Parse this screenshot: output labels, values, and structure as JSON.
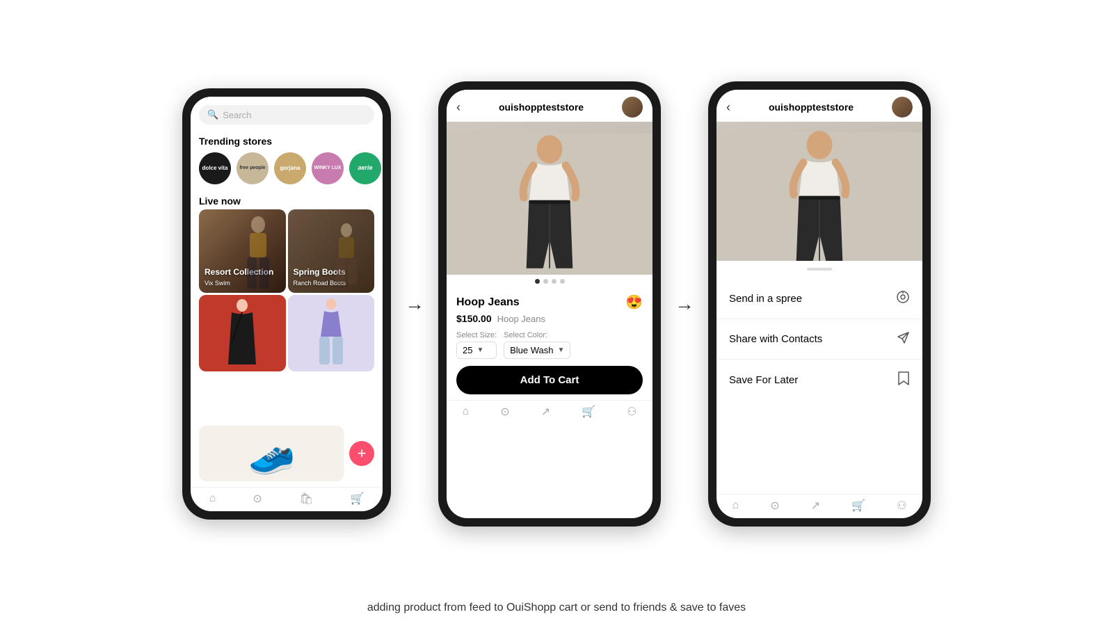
{
  "page": {
    "caption": "adding product from feed to OuiShopp cart or send to friends & save to faves"
  },
  "phone1": {
    "search_placeholder": "Search",
    "trending_title": "Trending stores",
    "stores": [
      {
        "name": "dolce vita",
        "bg": "#1a1a1a"
      },
      {
        "name": "free people",
        "bg": "#c8b89a"
      },
      {
        "name": "gorjana",
        "bg": "#c9a96e"
      },
      {
        "name": "WINKY LUX",
        "bg": "#c87bae"
      },
      {
        "name": "aerie",
        "bg": "#22a86b"
      }
    ],
    "live_title": "Live now",
    "live_cards": [
      {
        "label": "Resort Collection",
        "sub": "Vix Swim",
        "color": "#5a3e2b"
      },
      {
        "label": "Spring Boots",
        "sub": "Ranch Road Boots",
        "color": "#4a3520"
      }
    ]
  },
  "phone2": {
    "store_name": "ouishoppteststore",
    "product_title": "Hoop Jeans",
    "product_price": "$150.00",
    "product_name_sub": "Hoop Jeans",
    "size_label": "Select Size:",
    "size_value": "25",
    "color_label": "Select Color:",
    "color_value": "Blue Wash",
    "add_to_cart": "Add To Cart",
    "dots": [
      true,
      false,
      false,
      false
    ]
  },
  "phone3": {
    "store_name": "ouishoppteststore",
    "actions": [
      {
        "label": "Send in a spree",
        "icon": "⏱"
      },
      {
        "label": "Share with Contacts",
        "icon": "✉"
      },
      {
        "label": "Save For Later",
        "icon": "🔖"
      }
    ]
  },
  "arrows": {
    "symbol": "→"
  }
}
